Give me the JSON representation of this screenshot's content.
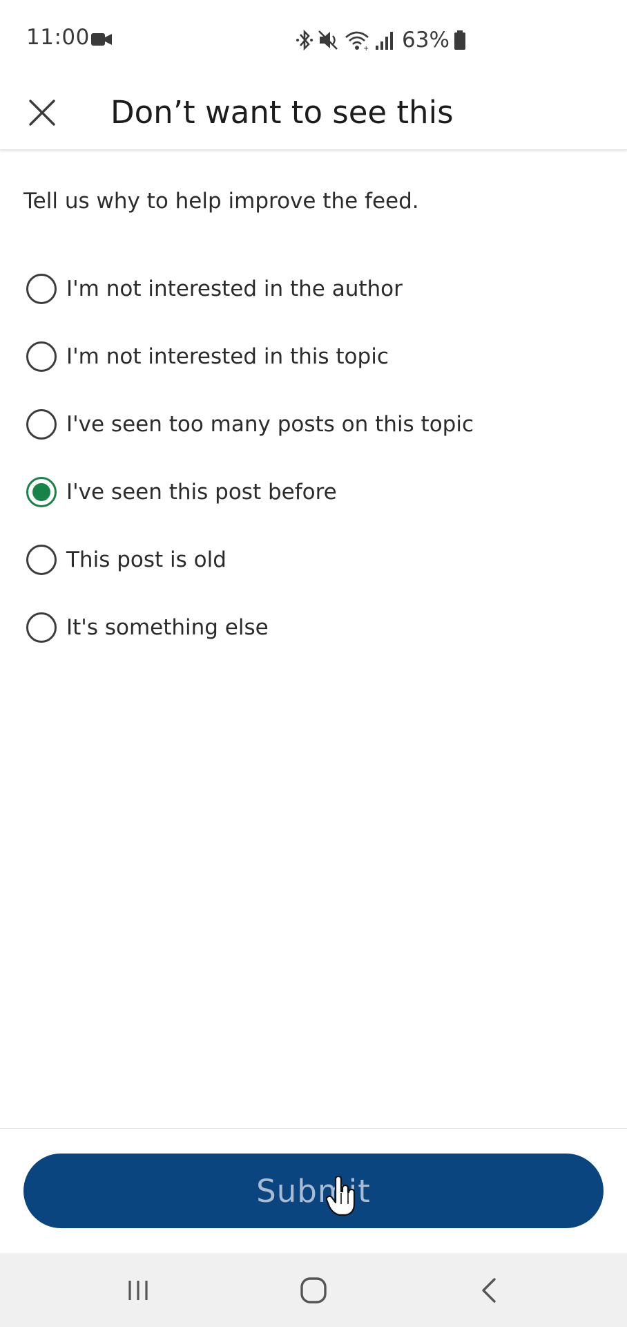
{
  "status_bar": {
    "time": "11:00",
    "battery_percent": "63%",
    "icons": [
      "camera-icon",
      "bluetooth-icon",
      "mute-icon",
      "wifi-icon",
      "signal-icon",
      "battery-icon"
    ]
  },
  "header": {
    "title": "Don’t want to see this",
    "close_icon": "close-icon"
  },
  "prompt": "Tell us why to help improve the feed.",
  "options": [
    {
      "label": "I'm not interested in the author",
      "selected": false
    },
    {
      "label": "I'm not interested in this topic",
      "selected": false
    },
    {
      "label": "I've seen too many posts on this topic",
      "selected": false
    },
    {
      "label": "I've seen this post before",
      "selected": true
    },
    {
      "label": "This post is old",
      "selected": false
    },
    {
      "label": "It's something else",
      "selected": false
    }
  ],
  "submit": {
    "label": "Submit"
  },
  "nav_bar": {
    "items": [
      "recents-icon",
      "home-icon",
      "back-icon"
    ]
  },
  "colors": {
    "accent_green": "#168448",
    "button_blue": "#0b4580",
    "button_text": "#a8bcd3",
    "nav_background": "#f0f0f0"
  }
}
